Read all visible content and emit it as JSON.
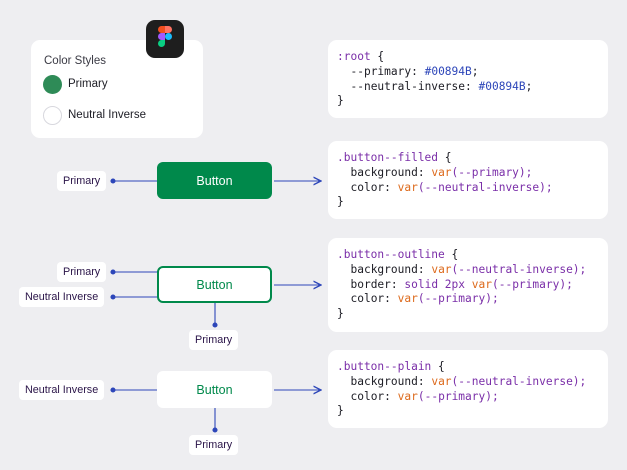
{
  "color_styles": {
    "title": "Color Styles",
    "items": [
      {
        "label": "Primary",
        "color": "#2e8b57"
      },
      {
        "label": "Neutral Inverse",
        "color": "#ffffff"
      }
    ]
  },
  "figma_icon": "figma-logo-icon",
  "code_root": {
    "selector": ":root",
    "lines": [
      {
        "prop": "--primary",
        "value": "#00894B"
      },
      {
        "prop": "--neutral-inverse",
        "value": "#00894B"
      }
    ]
  },
  "code_filled": {
    "selector": ".button--filled",
    "lines": [
      {
        "prop": "background",
        "value": "var(--primary);"
      },
      {
        "prop": "color",
        "value": "var(--neutral-inverse);"
      }
    ]
  },
  "code_outline": {
    "selector": ".button--outline",
    "lines": [
      {
        "prop": "background",
        "value": "var(--neutral-inverse);"
      },
      {
        "prop": "border",
        "value": "solid 2px var(--primary);"
      },
      {
        "prop": "color",
        "value": "var(--primary);"
      }
    ]
  },
  "code_plain": {
    "selector": ".button--plain",
    "lines": [
      {
        "prop": "background",
        "value": "var(--neutral-inverse);"
      },
      {
        "prop": "color",
        "value": "var(--primary);"
      }
    ]
  },
  "buttons": {
    "filled": "Button",
    "outline": "Button",
    "plain": "Button"
  },
  "tags": {
    "filled_primary": "Primary",
    "outline_primary": "Primary",
    "outline_neutral": "Neutral Inverse",
    "outline_bottom_primary": "Primary",
    "plain_neutral": "Neutral Inverse",
    "plain_bottom_primary": "Primary"
  },
  "colors": {
    "primary": "#00894B",
    "connector": "#2d46b9",
    "selector": "#7a2ea8",
    "hex": "#2d46b9",
    "function": "#dd6a1c"
  }
}
